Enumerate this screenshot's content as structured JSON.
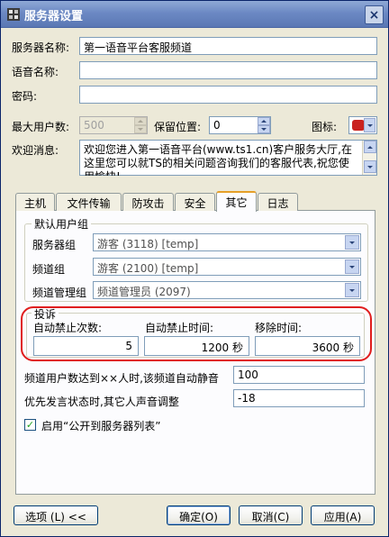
{
  "window": {
    "title": "服务器设置",
    "close_glyph": "×"
  },
  "general": {
    "server_name_label": "服务器名称:",
    "server_name_value": "第一语音平台客服频道",
    "voice_name_label": "语音名称:",
    "voice_name_value": "",
    "password_label": "密码:",
    "password_value": "",
    "max_users_label": "最大用户数:",
    "max_users_value": "500",
    "reserved_label": "保留位置:",
    "reserved_value": "0",
    "icon_label": "图标:",
    "welcome_label": "欢迎消息:",
    "welcome_text": "欢迎您进入第一语音平台(www.ts1.cn)客户服务大厅,在这里您可以就TS的相关问题咨询我们的客服代表,祝您使用愉快!"
  },
  "tabs": [
    {
      "label": "主机"
    },
    {
      "label": "文件传输"
    },
    {
      "label": "防攻击"
    },
    {
      "label": "安全"
    },
    {
      "label": "其它"
    },
    {
      "label": "日志"
    }
  ],
  "default_groups": {
    "title": "默认用户组",
    "server_group_label": "服务器组",
    "server_group_value": "游客 (3118) [temp]",
    "channel_group_label": "频道组",
    "channel_group_value": "游客 (2100) [temp]",
    "channel_admin_label": "频道管理组",
    "channel_admin_value": "频道管理员 (2097)"
  },
  "complaint": {
    "title": "投诉",
    "auto_ban_count_label": "自动禁止次数:",
    "auto_ban_count_value": "5",
    "auto_ban_time_label": "自动禁止时间:",
    "auto_ban_time_value": "1200 秒",
    "remove_time_label": "移除时间:",
    "remove_time_value": "3600 秒"
  },
  "other": {
    "auto_mute_label": "频道用户数达到××人时,该频道自动静音",
    "auto_mute_value": "100",
    "priority_label": "优先发言状态时,其它人声音调整",
    "priority_value": "-18",
    "publish_label": "启用“公开到服务器列表”",
    "publish_checked": true
  },
  "buttons": {
    "options": "选项 (L) <<",
    "ok": "确定(O)",
    "cancel": "取消(C)",
    "apply": "应用(A)"
  },
  "colors": {
    "highlight_outline": "#e01d1d",
    "title_bar": "#6c89c4",
    "active_tab_accent": "#e6a028"
  }
}
